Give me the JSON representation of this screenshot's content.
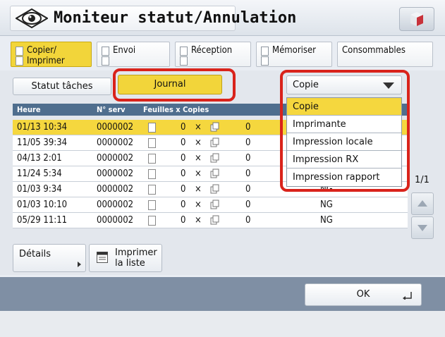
{
  "header": {
    "title": "Moniteur statut/Annulation",
    "icon": "eye-icon",
    "menu_icon": "cube-icon"
  },
  "tabs": [
    {
      "label_line1": "Copier/",
      "label_line2": "Imprimer",
      "active": true
    },
    {
      "label_line1": "Envoi",
      "label_line2": "",
      "active": false
    },
    {
      "label_line1": "Réception",
      "label_line2": "",
      "active": false
    },
    {
      "label_line1": "Mémoriser",
      "label_line2": "",
      "active": false
    },
    {
      "label_line1": "Consommables",
      "label_line2": "",
      "active": false
    }
  ],
  "view_buttons": {
    "status_label": "Statut tâches",
    "journal_label": "Journal"
  },
  "dropdown": {
    "selected": "Copie",
    "options": [
      "Copie",
      "Imprimante",
      "Impression locale",
      "Impression RX",
      "Impression rapport"
    ]
  },
  "table": {
    "columns": [
      "Heure",
      "N° serv",
      "Feuilles x Copies"
    ],
    "rows": [
      {
        "time": "01/13 10:34",
        "serv": "0000002",
        "sheets": "0",
        "copies": "0",
        "result": ""
      },
      {
        "time": "11/05 39:34",
        "serv": "0000002",
        "sheets": "0",
        "copies": "0",
        "result": ""
      },
      {
        "time": "04/13 2:01",
        "serv": "0000002",
        "sheets": "0",
        "copies": "0",
        "result": ""
      },
      {
        "time": "11/24 5:34",
        "serv": "0000002",
        "sheets": "0",
        "copies": "0",
        "result": ""
      },
      {
        "time": "01/03 9:34",
        "serv": "0000002",
        "sheets": "0",
        "copies": "0",
        "result": "NG"
      },
      {
        "time": "01/03 10:10",
        "serv": "0000002",
        "sheets": "0",
        "copies": "0",
        "result": "NG"
      },
      {
        "time": "05/29 11:11",
        "serv": "0000002",
        "sheets": "0",
        "copies": "0",
        "result": "NG"
      }
    ],
    "multiply_sign": "×"
  },
  "pagination": "1/1",
  "actions": {
    "details_label": "Détails",
    "print_list_line1": "Imprimer",
    "print_list_line2": "la liste",
    "ok_label": "OK"
  },
  "colors": {
    "accent": "#f2d53a",
    "highlight_border": "#d9231b",
    "table_header": "#4f6e8e"
  }
}
